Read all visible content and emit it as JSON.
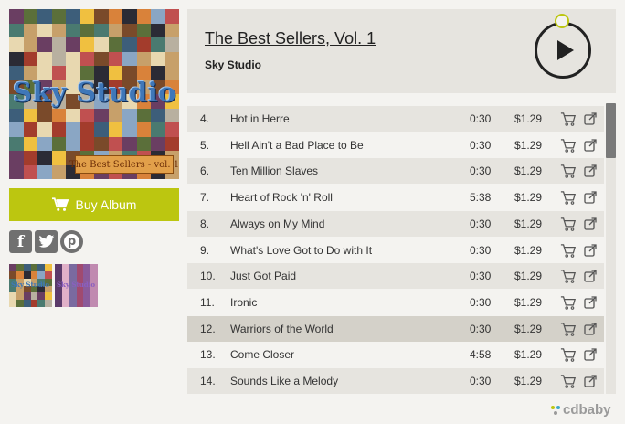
{
  "album": {
    "title": "The Best Sellers, Vol. 1",
    "artist": "Sky Studio",
    "cover_text": "Sky Studio",
    "cover_subtitle": "The Best Sellers - vol. 1",
    "thumb_text": "Sky Studio"
  },
  "buy_button": {
    "label": "Buy Album",
    "icon": "cart-icon",
    "color": "#bcc610"
  },
  "social": [
    {
      "name": "facebook-icon",
      "glyph": "f"
    },
    {
      "name": "twitter-icon",
      "glyph": "t"
    },
    {
      "name": "pinterest-icon",
      "glyph": "p"
    }
  ],
  "tracks": [
    {
      "num": "4.",
      "title": "Hot in Herre",
      "duration": "0:30",
      "price": "$1.29"
    },
    {
      "num": "5.",
      "title": "Hell Ain't a Bad Place to Be",
      "duration": "0:30",
      "price": "$1.29"
    },
    {
      "num": "6.",
      "title": "Ten Million Slaves",
      "duration": "0:30",
      "price": "$1.29"
    },
    {
      "num": "7.",
      "title": "Heart of Rock 'n' Roll",
      "duration": "5:38",
      "price": "$1.29"
    },
    {
      "num": "8.",
      "title": "Always on My Mind",
      "duration": "0:30",
      "price": "$1.29"
    },
    {
      "num": "9.",
      "title": "What's Love Got to Do with It",
      "duration": "0:30",
      "price": "$1.29"
    },
    {
      "num": "10.",
      "title": "Just Got Paid",
      "duration": "0:30",
      "price": "$1.29"
    },
    {
      "num": "11.",
      "title": "Ironic",
      "duration": "0:30",
      "price": "$1.29"
    },
    {
      "num": "12.",
      "title": "Warriors of the World",
      "duration": "0:30",
      "price": "$1.29",
      "active": true
    },
    {
      "num": "13.",
      "title": "Come Closer",
      "duration": "4:58",
      "price": "$1.29"
    },
    {
      "num": "14.",
      "title": "Sounds Like a Melody",
      "duration": "0:30",
      "price": "$1.29"
    }
  ],
  "branding": {
    "label": "cdbaby"
  },
  "colors": {
    "accent": "#bcc610",
    "row_odd": "#e6e4df",
    "row_even": "#f4f3f0",
    "row_active": "#d4d1c9"
  }
}
